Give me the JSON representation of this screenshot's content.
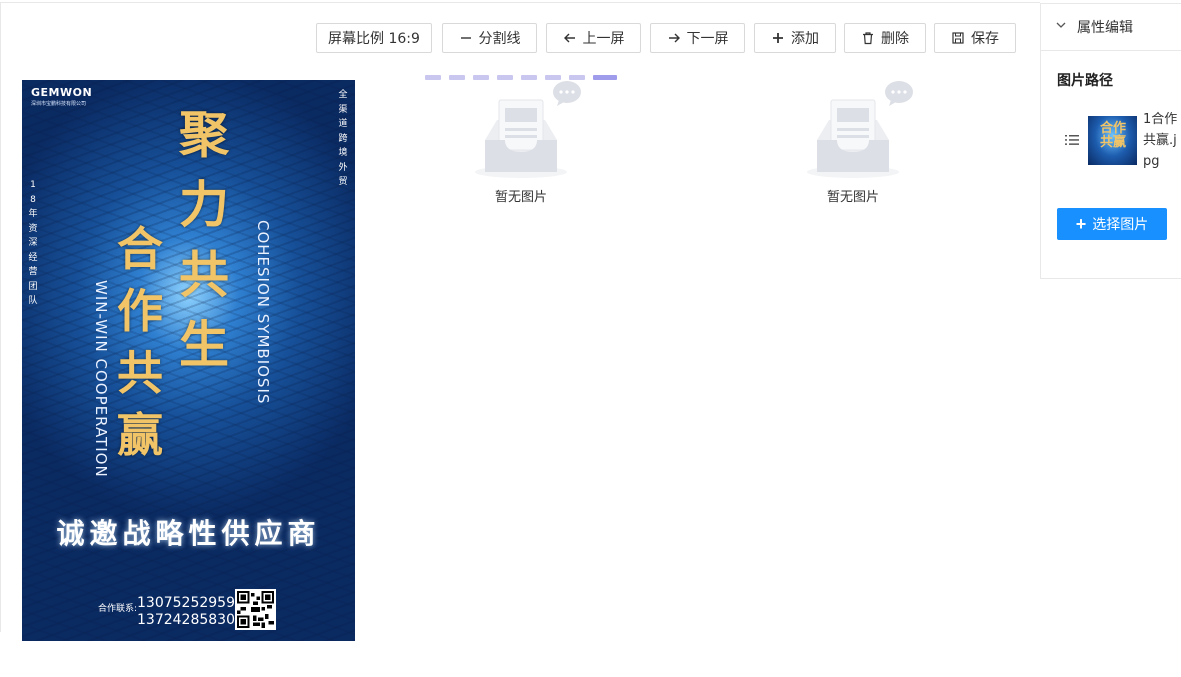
{
  "toolbar": {
    "ratio_label": "屏幕比例 16:9",
    "divider_label": "分割线",
    "prev_label": "上一屏",
    "next_label": "下一屏",
    "add_label": "添加",
    "delete_label": "删除",
    "save_label": "保存"
  },
  "pager": {
    "count": 8,
    "active_index": 7
  },
  "poster": {
    "brand": "GEMWON",
    "brand_sub": "深圳市宝鹏科技有限公司",
    "right_vertical": "全渠道跨境外贸",
    "left_vertical": "18年资深经营团队",
    "calligraphy_1": "聚力共生",
    "calligraphy_2": "合作共赢",
    "english_1": "COHESION SYMBIOSIS",
    "english_2": "WIN-WIN COOPERATION",
    "headline": "诚邀战略性供应商",
    "contact_label": "合作联系:",
    "phone_1": "13075252959",
    "phone_2": "13724285830"
  },
  "placeholders": [
    {
      "text": "暂无图片"
    },
    {
      "text": "暂无图片"
    }
  ],
  "panel": {
    "title": "属性编辑",
    "section_title": "图片路径",
    "file_name": "1合作共赢.jpg",
    "thumb_text": "合作共赢",
    "select_label": "选择图片"
  },
  "colors": {
    "primary": "#1890ff",
    "pager_inactive": "#c9c7ef",
    "pager_active": "#a09cec"
  }
}
